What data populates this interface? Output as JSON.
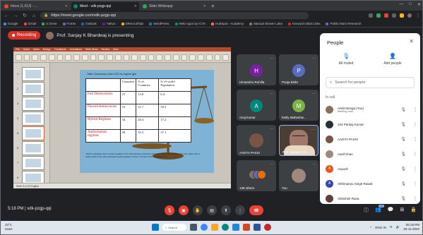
{
  "browser": {
    "tabs": [
      {
        "label": "Inbox (1,013) - ...",
        "color": "#ea4335",
        "active": false
      },
      {
        "label": "Meet - vdk-pzgp-qqi",
        "color": "#00897b",
        "active": true
      },
      {
        "label": "Slido Whiteapp",
        "color": "#34a853",
        "active": false
      }
    ],
    "new_tab": "+",
    "url": "https://meet.google.com/vdk-pzgp-qqi",
    "bookmarks": [
      {
        "label": "Google",
        "color": "#4285f4"
      },
      {
        "label": "Gmail",
        "color": "#ea4335"
      },
      {
        "label": "G Drive",
        "color": "#34a853"
      },
      {
        "label": "Forms",
        "color": "#7e57c2"
      },
      {
        "label": "Outlook",
        "color": "#1565c0"
      },
      {
        "label": "Yahoo",
        "color": "#6a1b9a"
      },
      {
        "label": "DRecruitTips",
        "color": "#f9a825"
      },
      {
        "label": "WordPress",
        "color": "#21759b"
      },
      {
        "label": "Web Apps by ICTA",
        "color": "#00897b"
      },
      {
        "label": "HubSpot - Academy",
        "color": "#ff7043"
      },
      {
        "label": "Manual Slower Labs",
        "color": "#8d6e63"
      },
      {
        "label": "Harvard Initial Links",
        "color": "#c62828"
      },
      {
        "label": "Public Mum Research",
        "color": "#5c6bc0"
      }
    ]
  },
  "meet": {
    "recording_label": "Recording",
    "presenting_text": "Prof. Sanjay K Bhardwaj is presenting",
    "meeting_time": "5:18 PM",
    "meeting_code": "vdk-pzgp-qqi",
    "tiles": [
      {
        "name": "Himanshu Rohilla",
        "initial": "H",
        "color": "#7b1fa2",
        "kind": "initial"
      },
      {
        "name": "Pooja Bisht",
        "initial": "P",
        "color": "#5c6bc0",
        "kind": "initial"
      },
      {
        "name": "Anuj kumar",
        "initial": "A",
        "color": "#00897b",
        "kind": "initial"
      },
      {
        "name": "Molly Maheshw...",
        "initial": "M",
        "color": "#7cb342",
        "kind": "initial"
      },
      {
        "name": "AADYA PASSI",
        "initial": "",
        "color": "#795548",
        "kind": "photo"
      },
      {
        "name": "Prof. Sanjay K B...",
        "initial": "",
        "color": "#4a3f35",
        "kind": "video"
      },
      {
        "name": "138 others",
        "initial": "",
        "color": "#3c4043",
        "kind": "others"
      },
      {
        "name": "You",
        "initial": "",
        "color": "#3c4043",
        "kind": "you"
      }
    ]
  },
  "slide": {
    "title": "Table: Democracy Index 2021 by regime type",
    "headers": [
      "",
      "Countries",
      "% of Countries",
      "% of world Population"
    ],
    "rows": [
      [
        "Full Democracies",
        "21",
        "12.6",
        "6.4"
      ],
      [
        "Flawed democracies",
        "53",
        "31.7",
        "39.3"
      ],
      [
        "Hybrid Regimes",
        "34",
        "20.4",
        "17.2"
      ],
      [
        "Authoritarian regimes",
        "59",
        "35.3",
        "37.1"
      ]
    ],
    "note": "\"World\" population refers to total population of the 167 countries covered by the Index. Since this excludes only micro states, this is nearly equal to the entire estimated world population. Source: The Economist Intelligence Unit"
  },
  "ppt": {
    "status": "Slide 5 of 20  English",
    "thumb_numbers": [
      "1",
      "2",
      "3",
      "4",
      "5",
      "6",
      "7",
      "8"
    ]
  },
  "people_panel": {
    "title": "People",
    "close": "✕",
    "actions": [
      {
        "label": "All muted",
        "icon": "mic-off-icon",
        "glyph": "🎙"
      },
      {
        "label": "Add people",
        "icon": "add-person-icon",
        "glyph": "👤"
      }
    ],
    "search_placeholder": "Search for people",
    "in_call_label": "In call",
    "participants": [
      {
        "name": "Ankit Monga (You)",
        "sub": "Meeting host",
        "color": "#8d6e63",
        "initial": ""
      },
      {
        "name": "104 Pankaj Kumar",
        "sub": "",
        "color": "#263238",
        "initial": ""
      },
      {
        "name": "AADYA PASSI",
        "sub": "",
        "color": "#795548",
        "initial": ""
      },
      {
        "name": "Aasif Khan",
        "sub": "",
        "color": "#a1887f",
        "initial": ""
      },
      {
        "name": "Aayush",
        "sub": "",
        "color": "#f4511e",
        "initial": "A"
      },
      {
        "name": "Abhimanyu Singh Rawat",
        "sub": "",
        "color": "#3949ab",
        "initial": "A"
      },
      {
        "name": "Abhishek Rana",
        "sub": "",
        "color": "#5d4037",
        "initial": ""
      }
    ]
  },
  "controls": {
    "people_count": "141"
  },
  "taskbar": {
    "weather_temp": "23°C",
    "weather_desc": "Haze",
    "search_label": "Search",
    "lang": "ENG",
    "region": "IN",
    "time": "05:18 PM",
    "date": "25-11-2022"
  }
}
